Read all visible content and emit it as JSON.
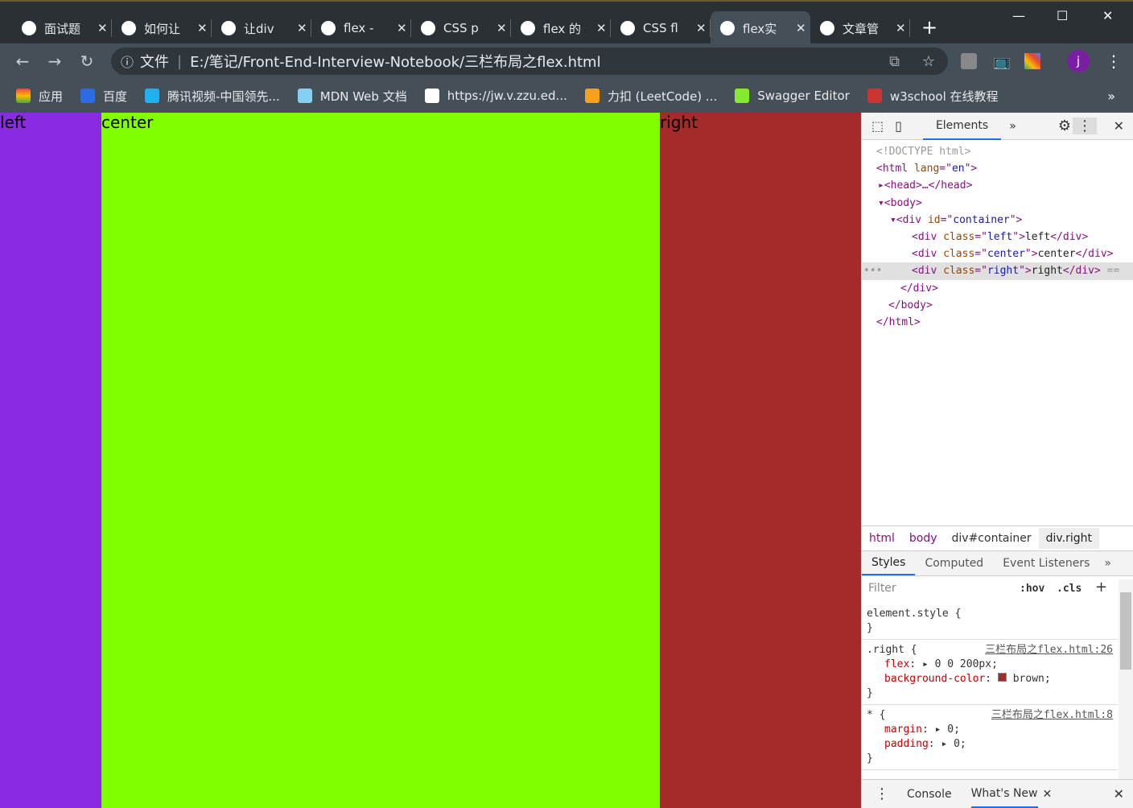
{
  "tabs": [
    {
      "title": "面试题",
      "favicon": "globe-icon"
    },
    {
      "title": "如何让",
      "favicon": "baidu-icon"
    },
    {
      "title": "让div",
      "favicon": "generic-icon"
    },
    {
      "title": "flex - ",
      "favicon": "mdn-icon"
    },
    {
      "title": "CSS p",
      "favicon": "code-icon"
    },
    {
      "title": "flex 的",
      "favicon": "code-icon"
    },
    {
      "title": "CSS fl",
      "favicon": "code-icon"
    },
    {
      "title": "flex实",
      "favicon": "globe-icon",
      "active": true
    },
    {
      "title": "文章管",
      "favicon": "csdn-icon"
    }
  ],
  "address": {
    "scheme_label": "文件",
    "url": "E:/笔记/Front-End-Interview-Notebook/三栏布局之flex.html"
  },
  "profile_initial": "j",
  "bookmarks": [
    {
      "label": "应用",
      "icon": "apps-icon"
    },
    {
      "label": "百度",
      "icon": "baidu-icon"
    },
    {
      "label": "腾讯视频-中国领先...",
      "icon": "tencent-video-icon"
    },
    {
      "label": "MDN Web 文档",
      "icon": "mdn-icon"
    },
    {
      "label": "https://jw.v.zzu.ed...",
      "icon": "globe-icon"
    },
    {
      "label": "力扣 (LeetCode) ...",
      "icon": "leetcode-icon"
    },
    {
      "label": "Swagger Editor",
      "icon": "swagger-icon"
    },
    {
      "label": "w3school 在线教程",
      "icon": "w3school-icon"
    }
  ],
  "page": {
    "left": {
      "text": "left",
      "color": "#8a2be2"
    },
    "center": {
      "text": "center",
      "color": "#7fff00"
    },
    "right": {
      "text": "right",
      "color": "#a52a2a"
    }
  },
  "devtools": {
    "panel_tab": "Elements",
    "dom": {
      "doctype": "<!DOCTYPE html>",
      "lang": "en",
      "container_id": "container",
      "children": [
        {
          "cls": "left",
          "text": "left"
        },
        {
          "cls": "center",
          "text": "center"
        },
        {
          "cls": "right",
          "text": "right"
        }
      ],
      "selected_suffix": "=="
    },
    "breadcrumbs": [
      "html",
      "body",
      "div#container",
      "div.right"
    ],
    "subtabs": [
      "Styles",
      "Computed",
      "Event Listeners"
    ],
    "filter_placeholder": "Filter",
    "hov": ":hov",
    "cls": ".cls",
    "rules": [
      {
        "selector": "element.style {",
        "source": "",
        "props": []
      },
      {
        "selector": ".right {",
        "source": "三栏布局之flex.html:26",
        "props": [
          {
            "name": "flex",
            "value": "0 0 200px;"
          },
          {
            "name": "background-color",
            "value": "brown;",
            "swatch": "#a52a2a"
          }
        ]
      },
      {
        "selector": "* {",
        "source": "三栏布局之flex.html:8",
        "props": [
          {
            "name": "margin",
            "value": "0;"
          },
          {
            "name": "padding",
            "value": "0;"
          }
        ]
      }
    ],
    "drawer_tabs": [
      "Console",
      "What's New"
    ]
  }
}
